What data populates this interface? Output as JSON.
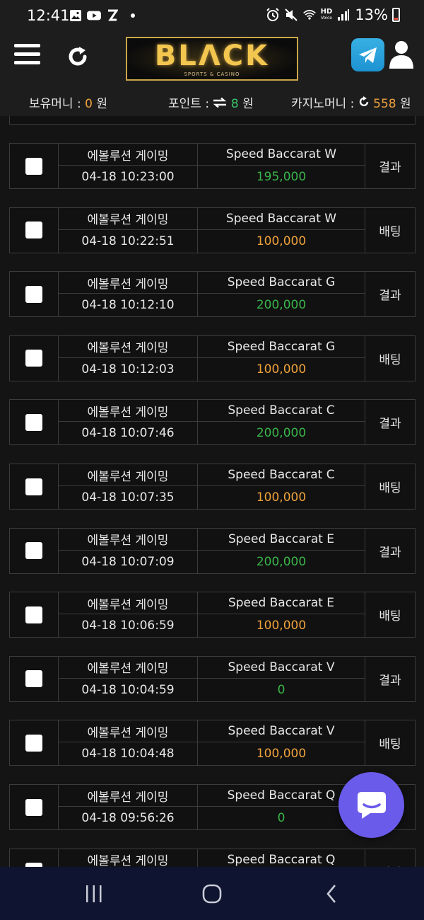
{
  "status_bar": {
    "time": "12:41",
    "battery": "13%",
    "hd_label_top": "HD",
    "hd_label_bottom": "Voice",
    "icons": [
      "gallery-icon",
      "youtube-icon",
      "z-icon",
      "alarm-icon",
      "mute-icon",
      "wifi-icon",
      "signal-icon",
      "battery-icon"
    ]
  },
  "header": {
    "logo_main": "BLΛCK",
    "logo_sub": "SPORTS & CASINO",
    "icons": [
      "menu-icon",
      "refresh-icon",
      "telegram-icon",
      "user-icon"
    ]
  },
  "balance": {
    "holding_label": "보유머니 : ",
    "holding_value": "0",
    "holding_unit": " 원",
    "points_label": "포인트 : ",
    "points_value": "8",
    "points_unit": " 원",
    "casino_label": "카지노머니 : ",
    "casino_value": "558",
    "casino_unit": " 원"
  },
  "bets": [
    {
      "provider": "에볼루션 게이밍",
      "game": "Speed Baccarat W",
      "datetime": "04-18 10:23:00",
      "amount": "195,000",
      "status": "결과"
    },
    {
      "provider": "에볼루션 게이밍",
      "game": "Speed Baccarat W",
      "datetime": "04-18 10:22:51",
      "amount": "100,000",
      "status": "배팅"
    },
    {
      "provider": "에볼루션 게이밍",
      "game": "Speed Baccarat G",
      "datetime": "04-18 10:12:10",
      "amount": "200,000",
      "status": "결과"
    },
    {
      "provider": "에볼루션 게이밍",
      "game": "Speed Baccarat G",
      "datetime": "04-18 10:12:03",
      "amount": "100,000",
      "status": "배팅"
    },
    {
      "provider": "에볼루션 게이밍",
      "game": "Speed Baccarat C",
      "datetime": "04-18 10:07:46",
      "amount": "200,000",
      "status": "결과"
    },
    {
      "provider": "에볼루션 게이밍",
      "game": "Speed Baccarat C",
      "datetime": "04-18 10:07:35",
      "amount": "100,000",
      "status": "배팅"
    },
    {
      "provider": "에볼루션 게이밍",
      "game": "Speed Baccarat E",
      "datetime": "04-18 10:07:09",
      "amount": "200,000",
      "status": "결과"
    },
    {
      "provider": "에볼루션 게이밍",
      "game": "Speed Baccarat E",
      "datetime": "04-18 10:06:59",
      "amount": "100,000",
      "status": "배팅"
    },
    {
      "provider": "에볼루션 게이밍",
      "game": "Speed Baccarat V",
      "datetime": "04-18 10:04:59",
      "amount": "0",
      "status": "결과"
    },
    {
      "provider": "에볼루션 게이밍",
      "game": "Speed Baccarat V",
      "datetime": "04-18 10:04:48",
      "amount": "100,000",
      "status": "배팅"
    },
    {
      "provider": "에볼루션 게이밍",
      "game": "Speed Baccarat Q",
      "datetime": "04-18 09:56:26",
      "amount": "0",
      "status": ""
    },
    {
      "provider": "에볼루션 게이밍",
      "game": "Speed Baccarat Q",
      "datetime": "",
      "amount": "",
      "status": "배팅"
    }
  ],
  "colors": {
    "result_amount": "#3ab54a",
    "bet_amount": "#f0a23c",
    "chat_button": "#6b5bea",
    "nav_bar": "#0f1430"
  },
  "nav": {
    "icons": [
      "recent-apps-icon",
      "home-icon",
      "back-icon"
    ]
  }
}
